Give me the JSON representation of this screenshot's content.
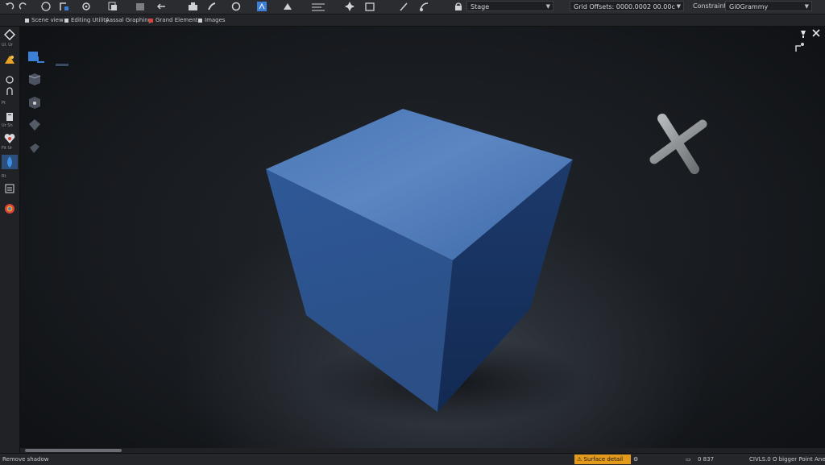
{
  "toolbar": {
    "icons": [
      "undo-icon",
      "redo-icon",
      "select-tool-icon",
      "gizmo-icon",
      "copy-icon",
      "stack-icon",
      "arrow-left-icon",
      "snap-icon",
      "brush-icon",
      "clear-icon",
      "bucket-icon",
      "shape-icon",
      "move-icon",
      "settings-icon",
      "cursor-icon",
      "grid-icon",
      "transform-icon",
      "frame-icon",
      "pen-icon",
      "paint-icon",
      "lock-icon"
    ],
    "stage_dropdown": "Stage",
    "path_field": "Grid Offsets: 0000.0002 00.00c",
    "mode_label": "Constraints",
    "layer_dropdown": "Gi0Grammy"
  },
  "tabs": [
    "Scene view",
    "Editing Utility",
    "Aassal Graphing",
    "Grand Element",
    "Images"
  ],
  "leftbar": {
    "labels": [
      "Ui. Ur",
      "Pt",
      "Ur Sh",
      "Fit Ur",
      "Rt"
    ]
  },
  "scene": {
    "cube_color": "#3d66a6",
    "bone_color": "#8a8d90"
  },
  "status": {
    "left": "Remove shadow",
    "warning": "Surface detail",
    "coords": "0 837",
    "right": "CIVLS.0 O bigger Point Aneunce"
  },
  "colors": {
    "accent": "#3b7fd6",
    "warning": "#e39a1a"
  }
}
